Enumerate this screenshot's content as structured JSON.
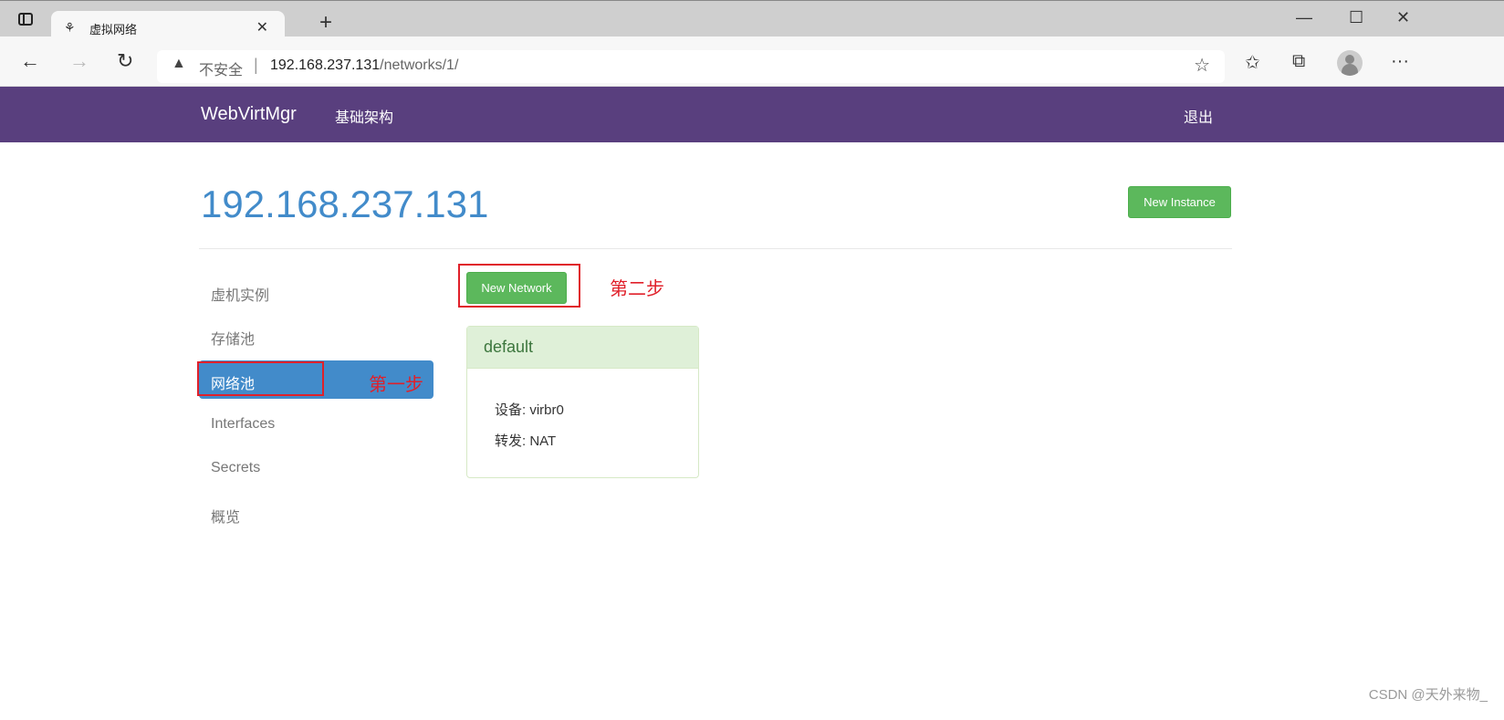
{
  "browser": {
    "tab_title": "虚拟网络",
    "url_host": "192.168.237.131",
    "url_path": "/networks/1/",
    "security_label": "不安全"
  },
  "navbar": {
    "brand": "WebVirtMgr",
    "infra": "基础架构",
    "logout": "退出"
  },
  "page": {
    "title": "192.168.237.131",
    "new_instance": "New Instance",
    "new_network": "New Network"
  },
  "sidebar": {
    "items": [
      {
        "label": "虚机实例"
      },
      {
        "label": "存储池"
      },
      {
        "label": "网络池"
      },
      {
        "label": "Interfaces"
      },
      {
        "label": "Secrets"
      },
      {
        "label": "概览"
      }
    ]
  },
  "annotations": {
    "step1": "第一步",
    "step2": "第二步"
  },
  "network": {
    "name": "default",
    "device": "设备: virbr0",
    "forward": "转发: NAT"
  },
  "watermark": "CSDN @天外来物_",
  "colors": {
    "navbar": "#593f7e",
    "primary": "#428bca",
    "success": "#5cb85c",
    "annotation": "#e0202a"
  }
}
